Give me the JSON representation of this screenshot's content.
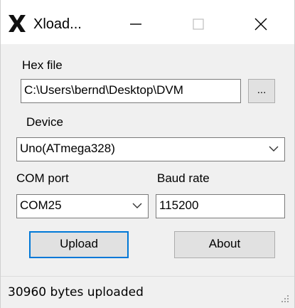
{
  "window": {
    "title": "Xload..."
  },
  "hex_file": {
    "label": "Hex file",
    "value": "C:\\Users\\bernd\\Desktop\\DVM",
    "browse_label": "..."
  },
  "device": {
    "label": "Device",
    "selected": "Uno(ATmega328)"
  },
  "com_port": {
    "label": "COM port",
    "selected": "COM25"
  },
  "baud_rate": {
    "label": "Baud rate",
    "value": "115200"
  },
  "buttons": {
    "upload_label": "Upload",
    "about_label": "About"
  },
  "status": {
    "text": "30960 bytes uploaded"
  },
  "colors": {
    "accent": "#0078d7",
    "background": "#f0f0f0"
  },
  "icons": {
    "app": "x-logo-icon",
    "minimize": "minimize-icon",
    "maximize": "maximize-icon",
    "close": "close-icon",
    "dropdown": "chevron-down-icon",
    "grip": "resize-grip-icon"
  }
}
